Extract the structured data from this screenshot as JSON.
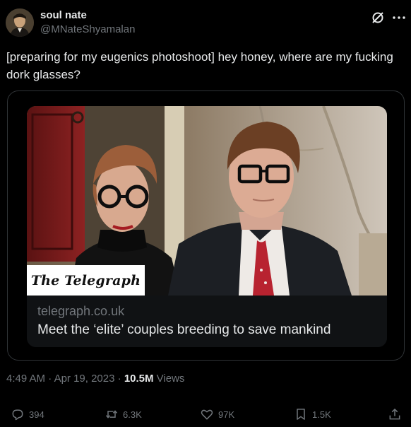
{
  "author": {
    "display_name": "soul nate",
    "handle": "@MNateShyamalan",
    "avatar_icon": "portrait-avatar"
  },
  "header_icons": {
    "grok": "grok-slash-icon",
    "more": "more-dots-icon"
  },
  "tweet": {
    "text": "[preparing for my eugenics photoshoot] hey honey, where are my fucking dork glasses?"
  },
  "card": {
    "source_badge": "The Telegraph",
    "domain": "telegraph.co.uk",
    "title": "Meet the ‘elite’ couples breeding to save mankind"
  },
  "meta": {
    "time": "4:49 AM",
    "separator1": " · ",
    "date": "Apr 19, 2023",
    "separator2": " · ",
    "views_count": "10.5M",
    "views_label": " Views"
  },
  "actions": {
    "replies": "394",
    "reposts": "6.3K",
    "likes": "97K",
    "bookmarks": "1.5K"
  },
  "colors": {
    "background": "#000000",
    "text_primary": "#e7e9ea",
    "text_secondary": "#71767b",
    "border": "#2f3336"
  }
}
